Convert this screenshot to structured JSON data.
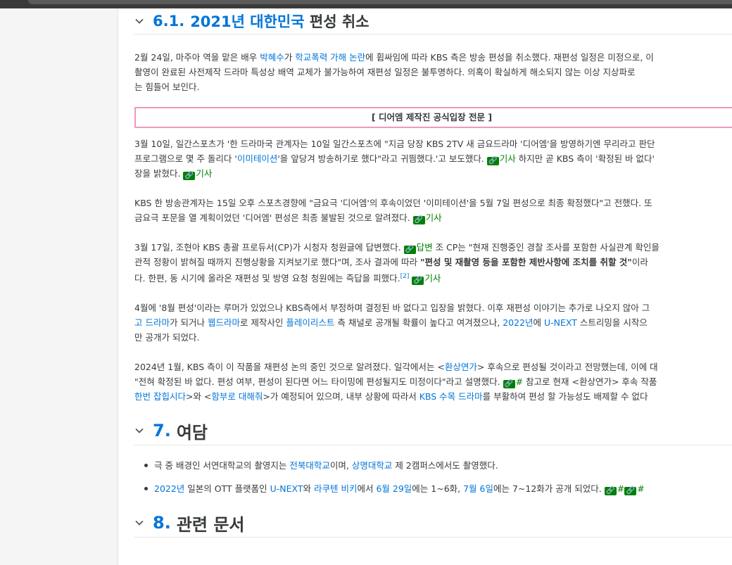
{
  "section61": {
    "num": "6.1.",
    "title_year": "2021년",
    "title_link": "대한민국",
    "title_rest": "편성 취소"
  },
  "p1": {
    "l1a": "2월 24일, 마주아 역을 맡은 배우 ",
    "l1_link1": "박혜수",
    "l1b": "가 ",
    "l1_link2": "학교폭력 가해 논란",
    "l1c": "에 휩싸임에 따라 KBS 측은 방송 편성을 취소했다. 재편성 일정은 미정으로, 이",
    "l2": "촬영이 완료된 사전제작 드라마 특성상 배역 교체가 불가능하여 재편성 일정은 불투명하다. 의혹이 확실하게 해소되지 않는 이상 지상파로",
    "l3": "는 힘들어 보인다."
  },
  "quotebox": {
    "label": "[ 디어엠 제작진 공식입장 전문 ]"
  },
  "p2": {
    "l1": "3월 10일, 일간스포츠가 '한 드라마국 관계자는 10일 일간스포츠에 \"지금 당장 KBS 2TV 새 금요드라마 '디어엠'을 방영하기엔 무리라고 판단",
    "l2a": "프로그램으로 몇 주 돌리다 '",
    "l2_link": "이미테이션",
    "l2b": "'을 앞당겨 방송하기로 했다\"라고 귀띔했다.'고 보도했다. ",
    "l2_ext": "기사",
    "l2c": " 하지만 곧 KBS 측이 '확정된 바 없다'",
    "l3a": "장을 밝혔다. ",
    "l3_ext": "기사"
  },
  "p3": {
    "l1": "KBS 한 방송관계자는 15일 오후 스포츠경향에 \"금요극 '디어엠'의 후속이었던 '이미테이션'을 5월 7일 편성으로 최종 확정했다\"고 전했다. 또",
    "l2a": "금요극 포문을 열 계획이었던 '디어엠' 편성은 최종 불발된 것으로 알려졌다. ",
    "l2_ext": "기사"
  },
  "p4": {
    "l1a": "3월 17일, 조현아 KBS 총괄 프로듀서(CP)가 시청자 청원글에 답변했다. ",
    "l1_ext": "답변",
    "l1b": " 조 CP는 \"현재 진행중인 경찰 조사를 포함한 사실관계 확인을",
    "l2a": "관적 정황이 밝혀질 때까지 진행상황을 지켜보기로 했다\"며, 조사 결과에 따라 ",
    "l2_bold": "\"편성 및 재촬영 등을 포함한 제반사항에 조치를 취할 것\"",
    "l2b": "이라",
    "l3a": "다. 한편, 동 시기에 올라온 재편성 및 방영 요청 청원에는 즉답을 피했다.",
    "l3_fn": "[2]",
    "l3_ext": "기사"
  },
  "p5": {
    "l1": "4월에 '8월 편성'이라는 루머가 있었으나 KBS측에서 부정하며 결정된 바 없다고 입장을 밝혔다. 이후 재편성 이야기는 추가로 나오지 않아 그",
    "l2_link1": "고 드라마",
    "l2a": "가 되거나 ",
    "l2_link2": "웹드라마",
    "l2b": "로 제작사인 ",
    "l2_link3": "플레이리스트",
    "l2c": " 측 채널로 공개될 확률이 높다고 여겨졌으나, ",
    "l2_link4": "2022년",
    "l2d": "에 ",
    "l2_link5": "U-NEXT",
    "l2e": " 스트리밍을 시작으",
    "l3": "만 공개가 되었다."
  },
  "p6": {
    "l1a": "2024년 1월, KBS 측이 이 작품을 재편성 논의 중인 것으로 알려졌다. 일각에서는 <",
    "l1_link": "환상연가",
    "l1b": "> 후속으로 편성될 것이라고 전망했는데, 이에 대",
    "l2a": "\"전혀 확정된 바 없다. 편성 여부, 편성이 된다면 어느 타이밍에 편성될지도 미정이다\"라고 설명했다. ",
    "l2_ext": "#",
    "l2b": " 참고로 현재 <환상연가> 후속 작품",
    "l3_link1": "한번 잡힙시다",
    "l3a": ">와 <",
    "l3_link2": "함부로 대해줘",
    "l3b": ">가 예정되어 있으며, 내부 상황에 따라서 ",
    "l3_link3": "KBS 수목 드라마",
    "l3c": "를 부활하여 편성 할 가능성도 배제할 수 없다"
  },
  "section7": {
    "num": "7.",
    "title": "여담"
  },
  "trivia": {
    "i1a": "극 중 배경인 서연대학교의 촬영지는 ",
    "i1_link1": "전북대학교",
    "i1b": "이며, ",
    "i1_link2": "상명대학교",
    "i1c": " 제 2캠퍼스에서도 촬영했다.",
    "i2_link1": "2022년",
    "i2a": " 일본의 OTT 플랫폼인 ",
    "i2_link2": "U-NEXT",
    "i2b": "와 ",
    "i2_link3": "라쿠텐 비키",
    "i2c": "에서 ",
    "i2_link4": "6월 29일",
    "i2d": "에는 1~6화, ",
    "i2_link5": "7월 6일",
    "i2e": "에는 7~12화가 공개 되었다. ",
    "i2_ext1": "#",
    "i2_ext2": "#"
  },
  "section8": {
    "num": "8.",
    "title": "관련 문서"
  },
  "icons": {
    "external_link": "🔗",
    "accent": "#0275d8",
    "external_color": "#008000",
    "quote_border": "#ef98bf"
  }
}
